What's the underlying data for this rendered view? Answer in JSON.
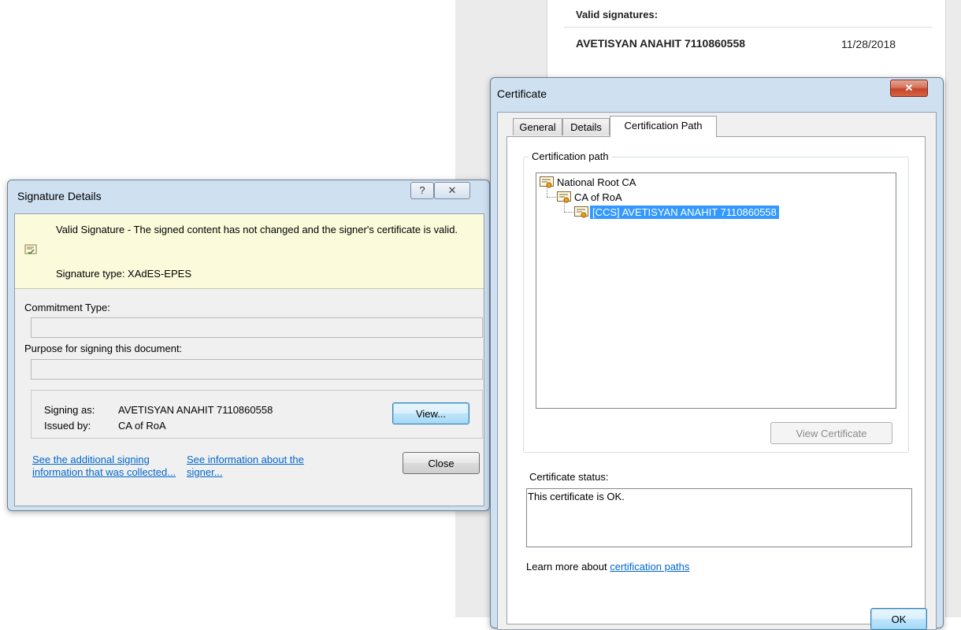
{
  "background_panel": {
    "valid_signatures_label": "Valid signatures:",
    "signer_name": "AVETISYAN ANAHIT 7110860558",
    "signer_date": "11/28/2018"
  },
  "signature_details": {
    "title": "Signature Details",
    "help_icon": "question-icon",
    "close_icon": "close-icon",
    "status_text": "Valid Signature - The signed content has not changed and the signer's certificate is valid.",
    "signature_type": "Signature type: XAdES-EPES",
    "commitment_label": "Commitment Type:",
    "commitment_value": "",
    "purpose_label": "Purpose for signing this document:",
    "purpose_value": "",
    "signing_as_label": "Signing as:",
    "signing_as_value": "AVETISYAN ANAHIT 7110860558",
    "issued_by_label": "Issued by:",
    "issued_by_value": "CA of RoA",
    "view_button": "View...",
    "close_button": "Close",
    "link_additional_info": "See the additional signing information that was collected...",
    "link_signer_info": "See information about the signer..."
  },
  "certificate": {
    "title": "Certificate",
    "close_icon": "close-icon",
    "tabs": [
      {
        "label": "General",
        "active": false
      },
      {
        "label": "Details",
        "active": false
      },
      {
        "label": "Certification Path",
        "active": true
      }
    ],
    "path_group_label": "Certification path",
    "tree": [
      {
        "label": "National Root CA",
        "level": 0,
        "selected": false
      },
      {
        "label": "CA of RoA",
        "level": 1,
        "selected": false
      },
      {
        "label": "[CCS] AVETISYAN ANAHIT 7110860558",
        "level": 2,
        "selected": true
      }
    ],
    "view_certificate_button": "View Certificate",
    "status_label": "Certificate status:",
    "status_value": "This certificate is OK.",
    "learn_more_prefix": "Learn more about ",
    "learn_more_link": "certification paths",
    "ok_button": "OK"
  },
  "colors": {
    "selection": "#3399ff",
    "link": "#0066cc",
    "info_bar": "#fbfbdc"
  }
}
